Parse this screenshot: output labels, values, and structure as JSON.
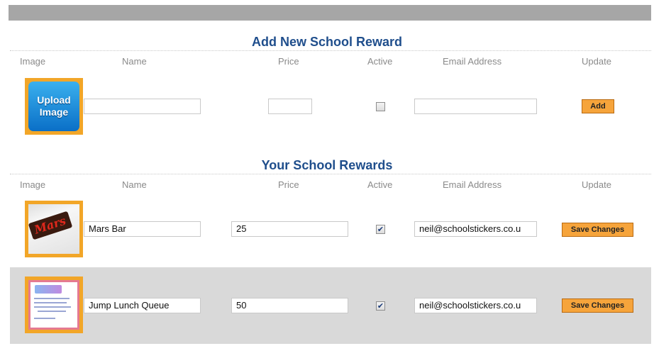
{
  "add_section": {
    "title": "Add New School Reward",
    "columns": {
      "image": "Image",
      "name": "Name",
      "price": "Price",
      "active": "Active",
      "email": "Email Address",
      "update": "Update"
    },
    "upload_label_line1": "Upload",
    "upload_label_line2": "Image",
    "name_value": "",
    "price_value": "",
    "active_checked": false,
    "email_value": "",
    "add_button": "Add"
  },
  "rewards_section": {
    "title": "Your School Rewards",
    "columns": {
      "image": "Image",
      "name": "Name",
      "price": "Price",
      "active": "Active",
      "email": "Email Address",
      "update": "Update"
    },
    "rows": [
      {
        "name": "Mars Bar",
        "price": "25",
        "active": true,
        "check_mark": "✔",
        "email": "neil@schoolstickers.co.u",
        "button": "Save Changes",
        "thumbnail_label": "Mars"
      },
      {
        "name": "Jump Lunch Queue",
        "price": "50",
        "active": true,
        "check_mark": "✔",
        "email": "neil@schoolstickers.co.u",
        "button": "Save Changes"
      }
    ]
  },
  "colors": {
    "accent": "#1f4e8c",
    "button": "#f6a43b",
    "thumb_border": "#f2a628",
    "row_highlight": "#d9d9d9"
  }
}
